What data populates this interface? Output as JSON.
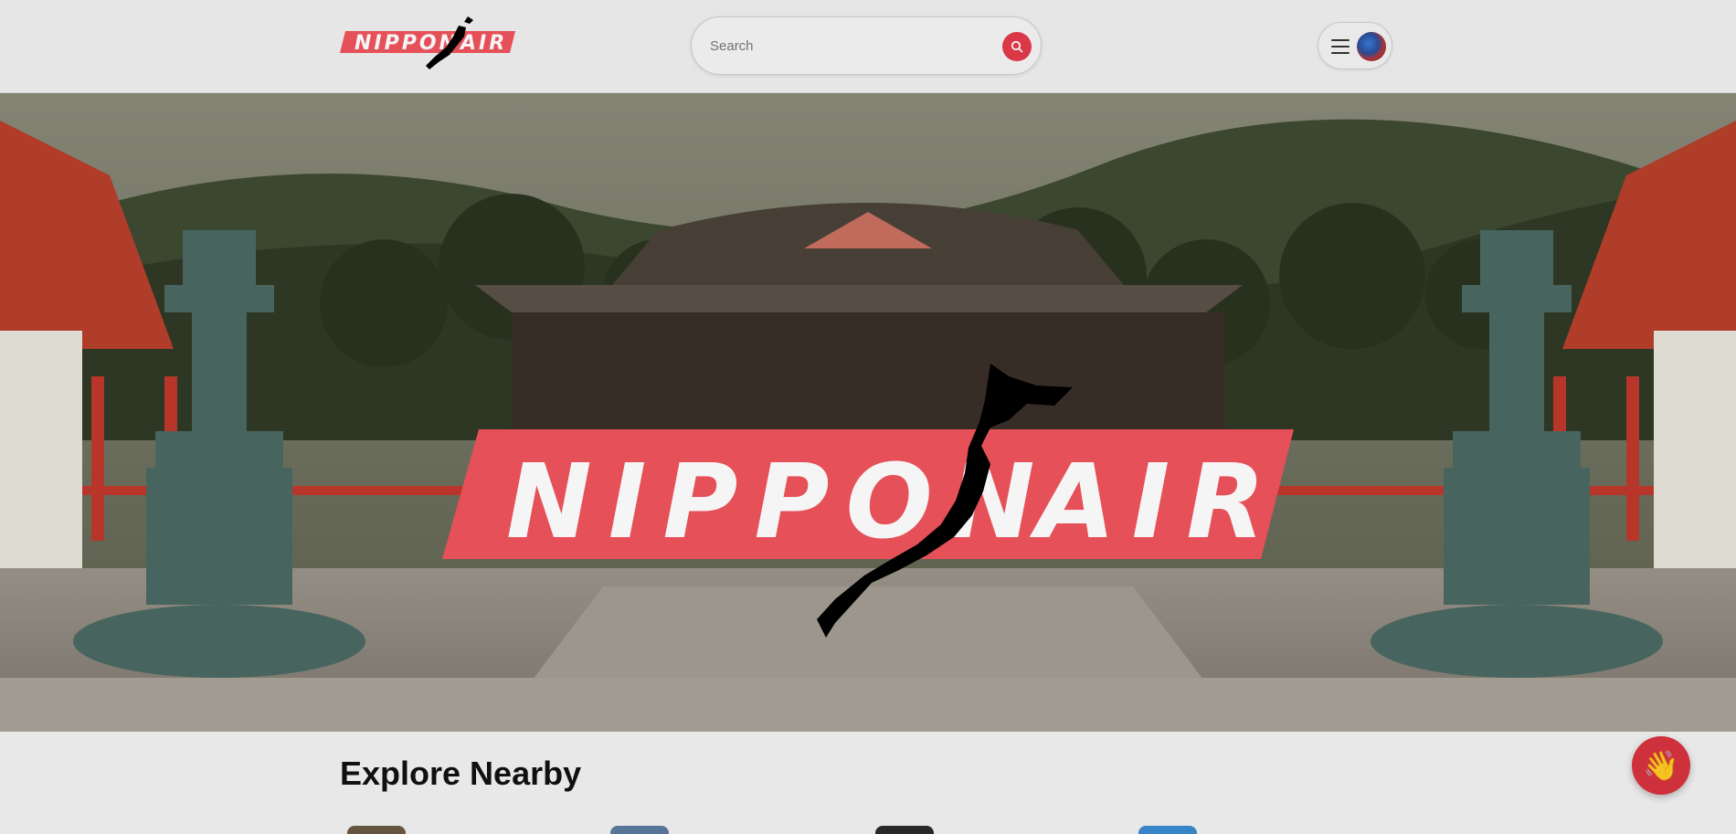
{
  "brand": {
    "name": "NIPPON AIR",
    "word1": "NIPPON",
    "word2": "AIR",
    "accent_color": "#f0545c"
  },
  "header": {
    "search": {
      "placeholder": "Search",
      "value": ""
    },
    "search_icon": "search-icon",
    "menu_icon": "hamburger-icon",
    "avatar_icon": "user-avatar"
  },
  "hero": {
    "scene": "shrine-courtyard-photo",
    "logo_word1": "NIPPON",
    "logo_word2": "AIR"
  },
  "explore": {
    "title": "Explore Nearby"
  },
  "floating_button": {
    "icon": "waving-hand-icon",
    "glyph": "👋",
    "color": "#d8333f"
  }
}
